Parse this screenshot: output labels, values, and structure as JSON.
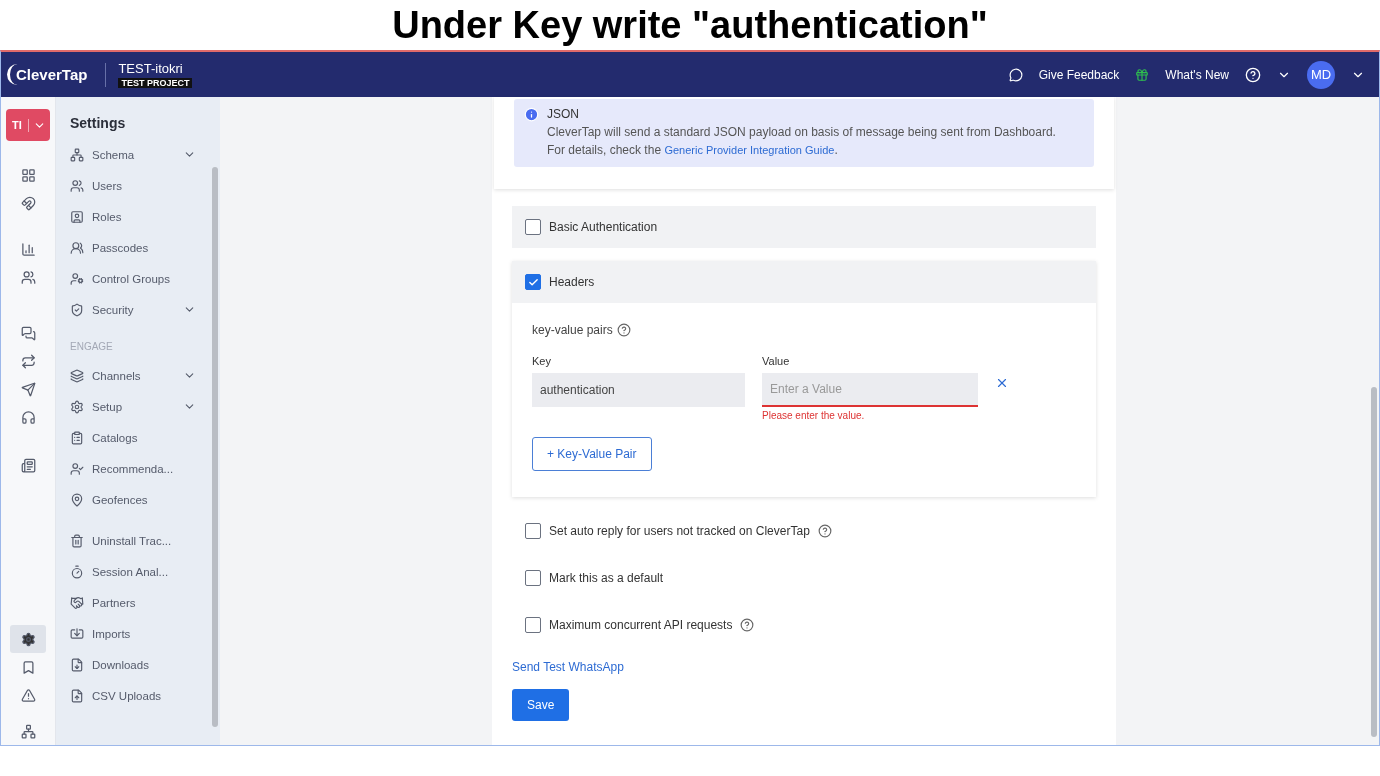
{
  "caption": "Under Key write \"authentication\"",
  "topbar": {
    "logo": "CleverTap",
    "project": "TEST-itokri",
    "project_badge": "TEST PROJECT",
    "feedback": "Give Feedback",
    "whats_new": "What's New",
    "avatar": "MD"
  },
  "rail": {
    "account": "TI"
  },
  "sidebar": {
    "title": "Settings",
    "groups": [
      {
        "items": [
          {
            "label": "Schema",
            "collapsible": true
          },
          {
            "label": "Users",
            "collapsible": false
          },
          {
            "label": "Roles",
            "collapsible": false
          },
          {
            "label": "Passcodes",
            "collapsible": false
          },
          {
            "label": "Control Groups",
            "collapsible": false
          },
          {
            "label": "Security",
            "collapsible": true
          }
        ]
      },
      {
        "heading": "ENGAGE",
        "items": [
          {
            "label": "Channels",
            "collapsible": true
          },
          {
            "label": "Setup",
            "collapsible": true
          },
          {
            "label": "Catalogs",
            "collapsible": false
          },
          {
            "label": "Recommenda...",
            "collapsible": false
          },
          {
            "label": "Geofences",
            "collapsible": false
          }
        ]
      },
      {
        "items": [
          {
            "label": "Uninstall Trac...",
            "collapsible": false
          },
          {
            "label": "Session Anal...",
            "collapsible": false
          },
          {
            "label": "Partners",
            "collapsible": false
          },
          {
            "label": "Imports",
            "collapsible": false
          },
          {
            "label": "Downloads",
            "collapsible": false
          },
          {
            "label": "CSV Uploads",
            "collapsible": false
          }
        ]
      }
    ]
  },
  "info": {
    "title": "JSON",
    "text": "CleverTap will send a standard JSON payload on basis of message being sent from Dashboard.",
    "detail": "For details, check the",
    "link": "Generic Provider Integration Guide",
    "detail_end": "."
  },
  "panels": [
    {
      "label": "Basic Authentication",
      "checked": false
    },
    {
      "label": "Headers",
      "checked": true,
      "pairs_label": "key-value pairs",
      "key_label": "Key",
      "value_label": "Value",
      "pairs": [
        {
          "key": "authentication",
          "value_placeholder": "Enter a Value",
          "error": "Please enter the value."
        }
      ],
      "add_button": "+ Key-Value Pair"
    }
  ],
  "options": [
    {
      "label": "Set auto reply for users not tracked on CleverTap",
      "checked": false,
      "help": true
    },
    {
      "label": "Mark this as a default",
      "checked": false,
      "help": false
    },
    {
      "label": "Maximum concurrent API requests",
      "checked": false,
      "help": true
    }
  ],
  "test_link": "Send Test WhatsApp",
  "save": "Save"
}
